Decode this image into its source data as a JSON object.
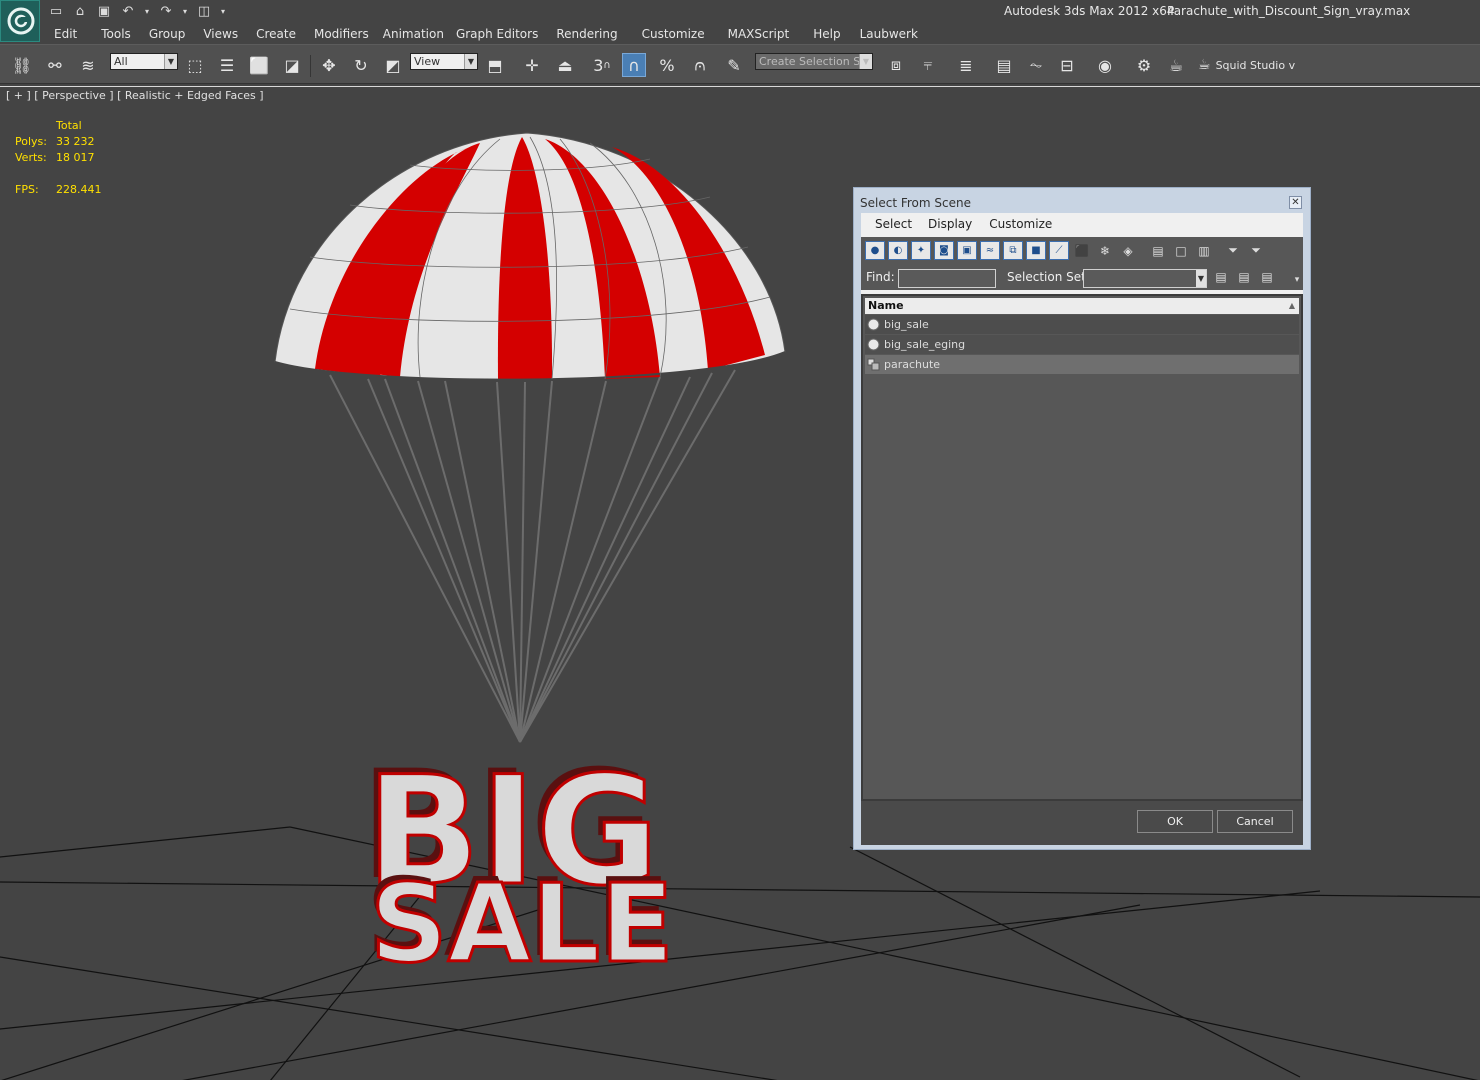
{
  "window": {
    "app_title": "Autodesk 3ds Max  2012 x64",
    "file_title": "Parachute_with_Discount_Sign_vray.max"
  },
  "menubar": {
    "items": [
      "Edit",
      "Tools",
      "Group",
      "Views",
      "Create",
      "Modifiers",
      "Animation",
      "Graph Editors",
      "Rendering",
      "Customize",
      "MAXScript",
      "Help",
      "Laubwerk"
    ]
  },
  "toolbar": {
    "selection_filter": "All",
    "reference_coordinate_system": "View",
    "named_selection_placeholder": "Create Selection Se",
    "snap_angle_label": "3",
    "workspace_label": "Squid Studio v"
  },
  "viewport": {
    "label": "[ + ] [ Perspective ] [ Realistic + Edged Faces ]",
    "stats": {
      "header": "Total",
      "polys_label": "Polys:",
      "polys_value": "33 232",
      "verts_label": "Verts:",
      "verts_value": "18 017",
      "fps_label": "FPS:",
      "fps_value": "228.441"
    },
    "sign_line1": "BIG",
    "sign_line2": "SALE"
  },
  "dialog": {
    "title": "Select From Scene",
    "menu": [
      "Select",
      "Display",
      "Customize"
    ],
    "find_label": "Find:",
    "find_value": "",
    "selection_set_label": "Selection Set:",
    "list_header": "Name",
    "objects": [
      {
        "name": "big_sale",
        "icon": "sphere-icon"
      },
      {
        "name": "big_sale_eging",
        "icon": "sphere-icon"
      },
      {
        "name": "parachute",
        "icon": "group-icon"
      }
    ],
    "selected_index": 2,
    "ok_label": "OK",
    "cancel_label": "Cancel"
  },
  "colors": {
    "viewport_bg": "#444444",
    "stats_text": "#ffe000",
    "canopy_red": "#d40000",
    "canopy_white": "#e6e6e6",
    "dialog_frame": "#c8d4e3"
  }
}
